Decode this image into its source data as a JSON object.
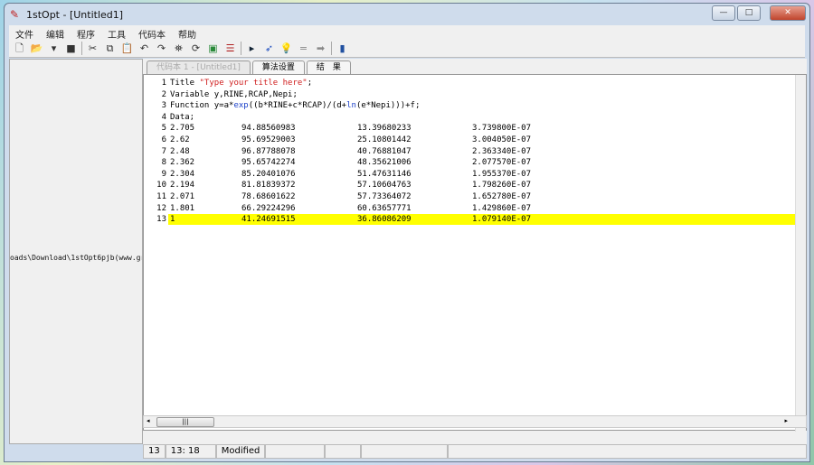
{
  "window": {
    "title": "1stOpt - [Untitled1]",
    "controls": [
      "—",
      "□",
      "✕"
    ]
  },
  "menu": [
    "文件",
    "编辑",
    "程序",
    "工具",
    "代码本",
    "帮助"
  ],
  "toolbar": [
    "new-file",
    "open",
    "dropdown",
    "save",
    "cut",
    "copy",
    "paste",
    "undo",
    "redo",
    "find",
    "replace",
    "chart",
    "import",
    "run",
    "auto-run",
    "hint",
    "equals",
    "export",
    "book"
  ],
  "left_panel": {
    "path": "oads\\Download\\1stOpt6pjb(www.gr"
  },
  "tabs": [
    "代码本 1 - [Untitled1]",
    "算法设置",
    "结　果"
  ],
  "code": {
    "line1": {
      "kw": "Title ",
      "str": "\"Type your title here\"",
      "rest": ";"
    },
    "line2": "Variable y,RINE,RCAP,Nepi;",
    "line3": {
      "a": "Function y=a*",
      "exp": "exp",
      "b": "((b*RINE+c*RCAP)/(d+",
      "ln": "ln",
      "c": "(e*Nepi)))+f;"
    },
    "line4": "Data;",
    "rows": [
      [
        "2.705",
        "94.88560983",
        "13.39680233",
        "3.739800E-07"
      ],
      [
        "2.62",
        "95.69529003",
        "25.10801442",
        "3.004050E-07"
      ],
      [
        "2.48",
        "96.87788078",
        "40.76881047",
        "2.363340E-07"
      ],
      [
        "2.362",
        "95.65742274",
        "48.35621006",
        "2.077570E-07"
      ],
      [
        "2.304",
        "85.20401076",
        "51.47631146",
        "1.955370E-07"
      ],
      [
        "2.194",
        "81.81839372",
        "57.10604763",
        "1.798260E-07"
      ],
      [
        "2.071",
        "78.68601622",
        "57.73364072",
        "1.652780E-07"
      ],
      [
        "1.801",
        "66.29224296",
        "60.63657771",
        "1.429860E-07"
      ],
      [
        "1",
        "41.24691515",
        "36.86086209",
        "1.079140E-07"
      ]
    ],
    "highlight_color": "#ffff00"
  },
  "status": {
    "line": "13",
    "pos": "13: 18",
    "state": "Modified"
  }
}
